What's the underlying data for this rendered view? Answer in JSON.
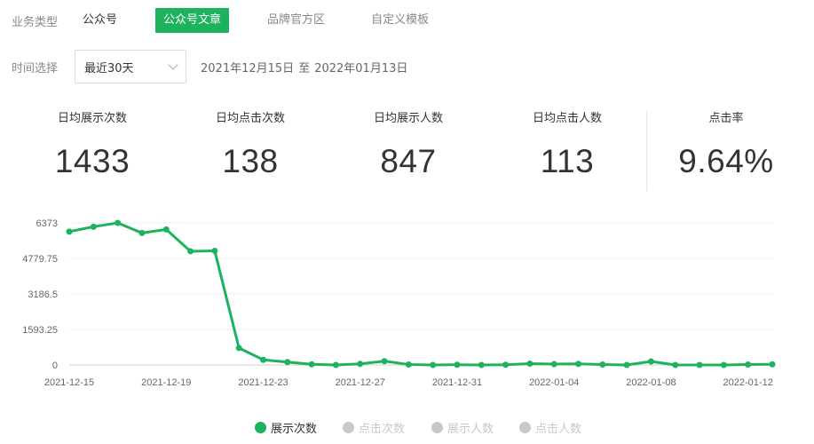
{
  "filters": {
    "business_type_label": "业务类型",
    "tabs": [
      {
        "label": "公众号",
        "active": false
      },
      {
        "label": "公众号文章",
        "active": true
      },
      {
        "label": "品牌官方区",
        "active": false
      },
      {
        "label": "自定义模板",
        "active": false
      }
    ],
    "time_label": "时间选择",
    "time_select_value": "最近30天",
    "range_start": "2021年12月15日",
    "range_sep": "至",
    "range_end": "2022年01月13日"
  },
  "metrics": [
    {
      "label": "日均展示次数",
      "value": "1433"
    },
    {
      "label": "日均点击次数",
      "value": "138"
    },
    {
      "label": "日均展示人数",
      "value": "847"
    },
    {
      "label": "日均点击人数",
      "value": "113"
    },
    {
      "label": "点击率",
      "value": "9.64%"
    }
  ],
  "colors": {
    "accent": "#1db35e",
    "inactive_legend": "#c8c8c8"
  },
  "legend": [
    {
      "label": "展示次数",
      "active": true
    },
    {
      "label": "点击次数",
      "active": false
    },
    {
      "label": "展示人数",
      "active": false
    },
    {
      "label": "点击人数",
      "active": false
    }
  ],
  "chart_data": {
    "type": "line",
    "x": [
      "2021-12-15",
      "2021-12-16",
      "2021-12-17",
      "2021-12-18",
      "2021-12-19",
      "2021-12-20",
      "2021-12-21",
      "2021-12-22",
      "2021-12-23",
      "2021-12-24",
      "2021-12-25",
      "2021-12-26",
      "2021-12-27",
      "2021-12-28",
      "2021-12-29",
      "2021-12-30",
      "2021-12-31",
      "2022-01-01",
      "2022-01-02",
      "2022-01-03",
      "2022-01-04",
      "2022-01-05",
      "2022-01-06",
      "2022-01-07",
      "2022-01-08",
      "2022-01-09",
      "2022-01-10",
      "2022-01-11",
      "2022-01-12",
      "2022-01-13"
    ],
    "series": [
      {
        "name": "展示次数",
        "values": [
          5980,
          6200,
          6373,
          5920,
          6080,
          5100,
          5120,
          760,
          230,
          130,
          30,
          0,
          50,
          170,
          20,
          0,
          10,
          0,
          10,
          60,
          40,
          50,
          20,
          0,
          160,
          0,
          0,
          0,
          20,
          30
        ]
      }
    ],
    "x_tick_labels": [
      "2021-12-15",
      "2021-12-19",
      "2021-12-23",
      "2021-12-27",
      "2021-12-31",
      "2022-01-04",
      "2022-01-08",
      "2022-01-12"
    ],
    "y_tick_labels": [
      "0",
      "1593.25",
      "3186.5",
      "4779.75",
      "6373"
    ],
    "ylim": [
      0,
      6373
    ],
    "grid": true
  }
}
